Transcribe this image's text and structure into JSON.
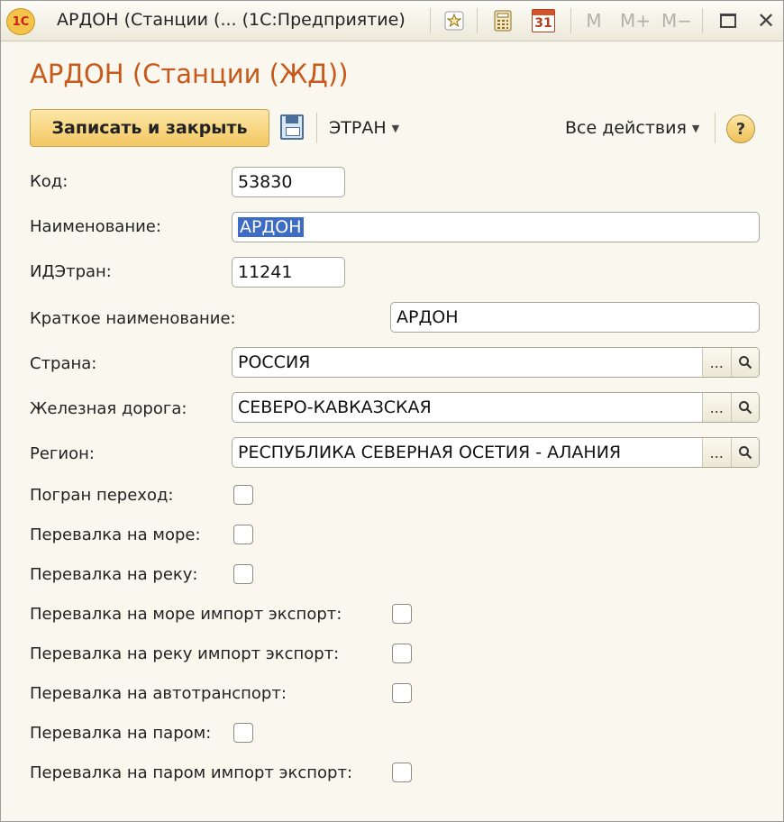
{
  "window": {
    "logo": "1С",
    "title": "АРДОН (Станции (...  (1С:Предприятие)",
    "toolbar": {
      "m": "M",
      "m_plus": "M+",
      "m_minus": "M−",
      "calendar_day": "31"
    }
  },
  "form": {
    "title": "АРДОН (Станции (ЖД))",
    "save_close_label": "Записать и закрыть",
    "etran_menu": "ЭТРАН",
    "all_actions": "Все действия",
    "help": "?"
  },
  "fields": {
    "code": {
      "label": "Код:",
      "value": "53830"
    },
    "name": {
      "label": "Наименование:",
      "value": "АРДОН"
    },
    "idetran": {
      "label": "ИДЭтран:",
      "value": "11241"
    },
    "short_name": {
      "label": "Краткое наименование:",
      "value": "АРДОН"
    },
    "country": {
      "label": "Страна:",
      "value": "РОССИЯ"
    },
    "railway": {
      "label": "Железная дорога:",
      "value": "СЕВЕРО-КАВКАЗСКАЯ"
    },
    "region": {
      "label": "Регион:",
      "value": "РЕСПУБЛИКА СЕВЕРНАЯ ОСЕТИЯ - АЛАНИЯ"
    },
    "picker_dots": "...",
    "search_icon": "search-icon"
  },
  "checkboxes": [
    {
      "label": "Погран переход:",
      "checked": false
    },
    {
      "label": "Перевалка на море:",
      "checked": false
    },
    {
      "label": "Перевалка на реку:",
      "checked": false
    },
    {
      "label": "Перевалка на море импорт экспорт:",
      "checked": false
    },
    {
      "label": "Перевалка на реку импорт экспорт:",
      "checked": false
    },
    {
      "label": "Перевалка на автотранспорт:",
      "checked": false
    },
    {
      "label": "Перевалка на паром:",
      "checked": false
    },
    {
      "label": "Перевалка на паром импорт экспорт:",
      "checked": false
    }
  ]
}
